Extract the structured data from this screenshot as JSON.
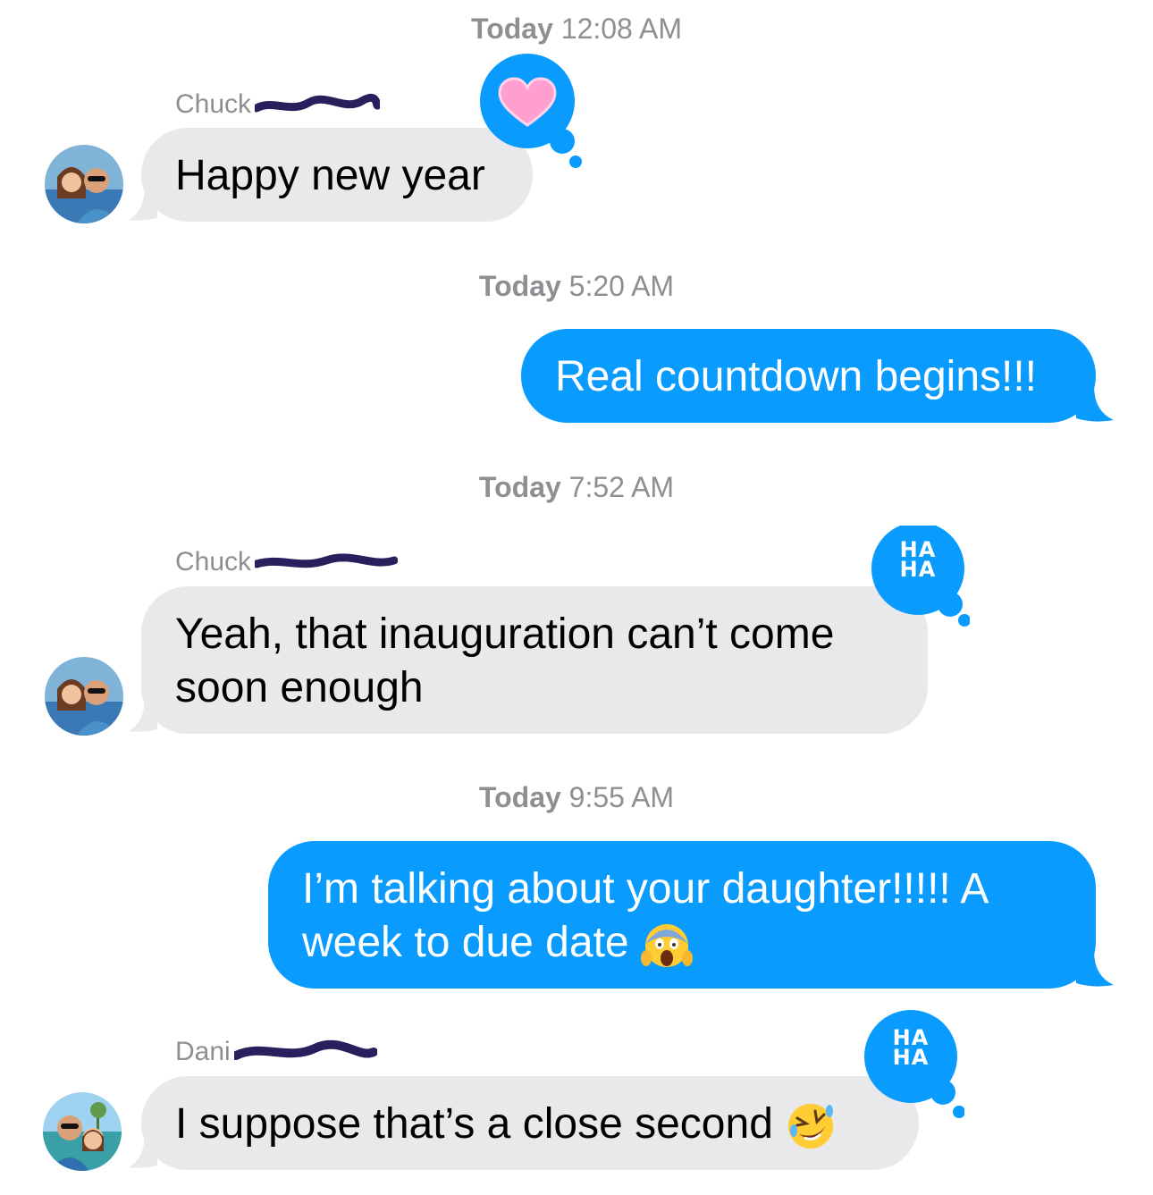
{
  "colors": {
    "incoming_bubble": "#e9e9eb",
    "outgoing_bubble": "#0a9bff",
    "tapback": "#0a9bff",
    "timestamp": "#8e8e93"
  },
  "messages": [
    {
      "timestamp_day": "Today",
      "timestamp_time": "12:08 AM",
      "sender": "Chuck",
      "text": "Happy new year",
      "direction": "incoming",
      "tapback": "heart"
    },
    {
      "timestamp_day": "Today",
      "timestamp_time": "5:20 AM",
      "text": "Real countdown begins!!!",
      "direction": "outgoing"
    },
    {
      "timestamp_day": "Today",
      "timestamp_time": "7:52 AM",
      "sender": "Chuck",
      "text": "Yeah, that inauguration can’t come soon enough",
      "direction": "incoming",
      "tapback": "haha",
      "tapback_text": "HA HA"
    },
    {
      "timestamp_day": "Today",
      "timestamp_time": "9:55 AM",
      "text": "I’m talking about your daughter!!!!!  A week to due date",
      "direction": "outgoing",
      "emoji": "screaming-face-emoji"
    },
    {
      "sender": "Dani",
      "text": "I suppose that’s a close second",
      "direction": "incoming",
      "tapback": "haha",
      "tapback_text": "HA HA",
      "emoji": "rolling-on-floor-laughing-emoji"
    }
  ]
}
